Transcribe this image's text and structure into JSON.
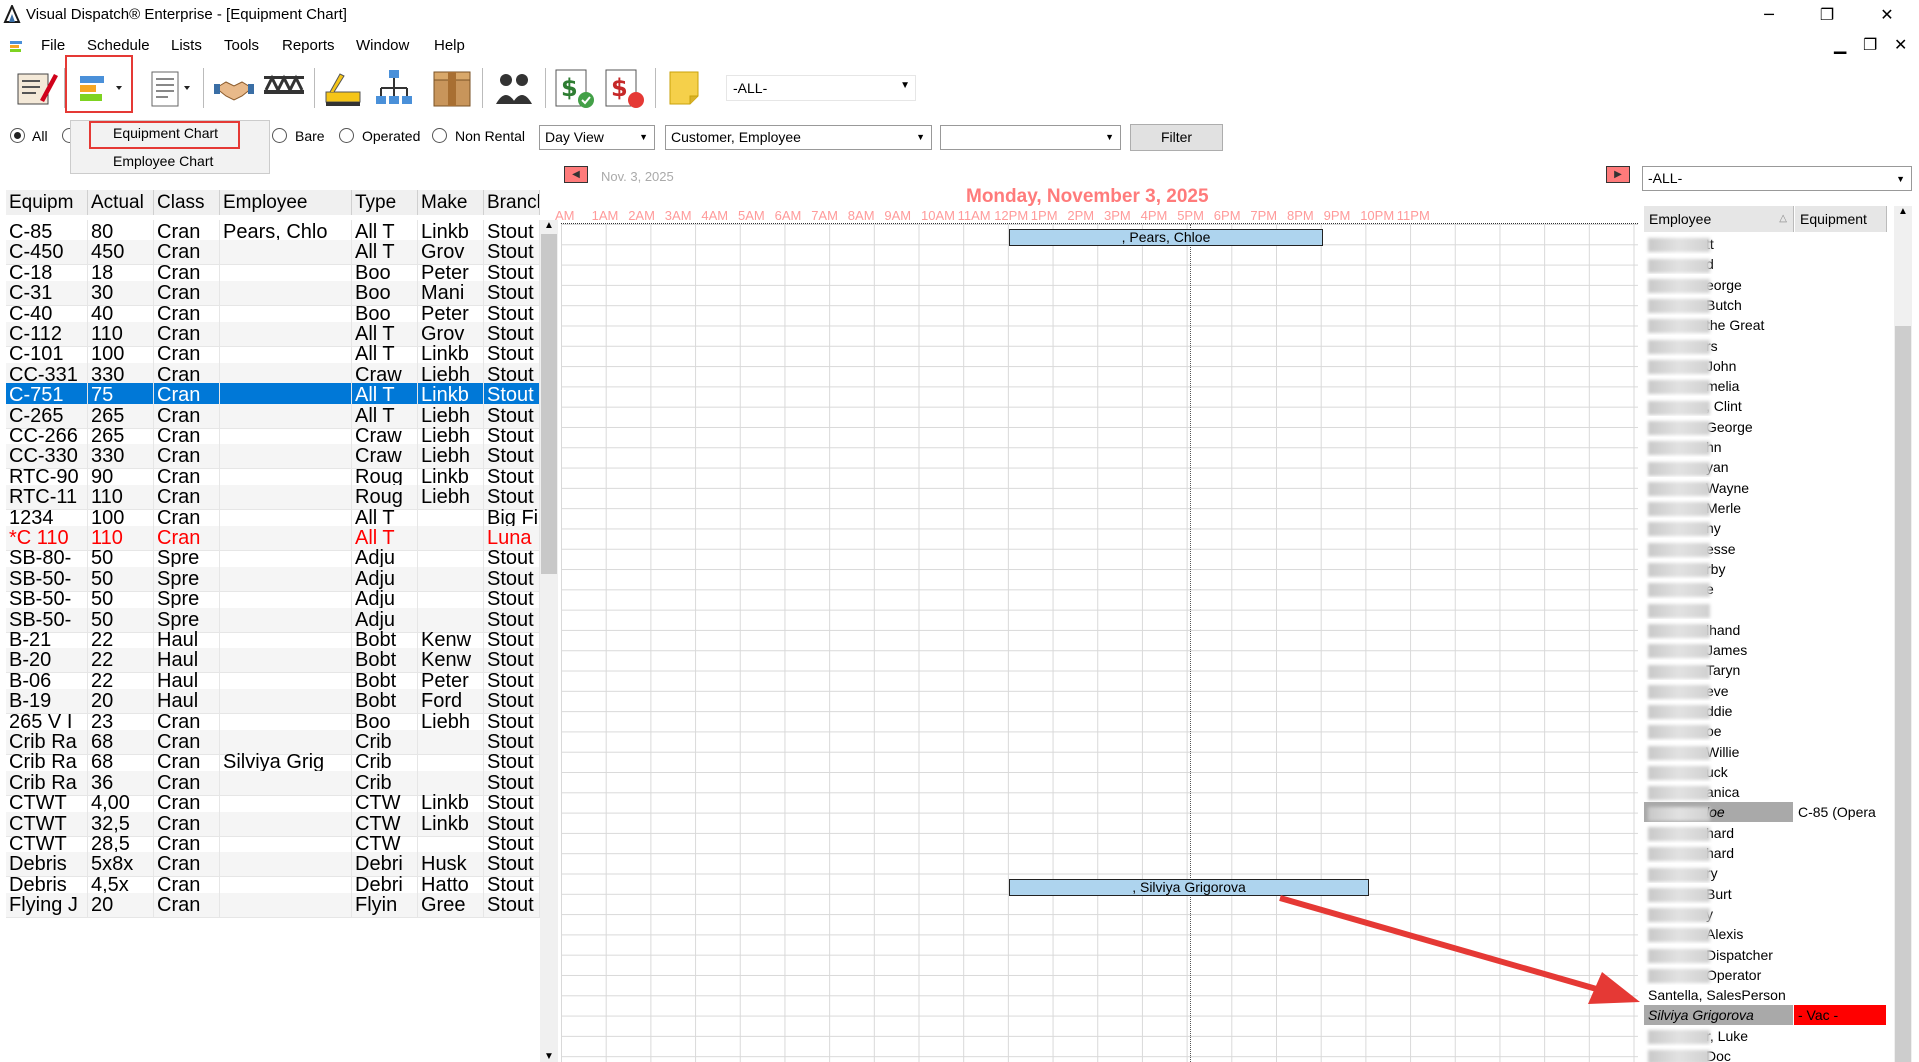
{
  "window": {
    "title": "Visual Dispatch® Enterprise - [Equipment Chart]"
  },
  "menu": [
    "File",
    "Schedule",
    "Lists",
    "Tools",
    "Reports",
    "Window",
    "Help"
  ],
  "toolbar": {
    "all_select": "-ALL-"
  },
  "chart_menu": {
    "equipment": "Equipment Chart",
    "employee": "Employee Chart"
  },
  "filters": {
    "radio_all": "All",
    "radio_bare": "Bare",
    "radio_operated": "Operated",
    "radio_nonrental": "Non Rental",
    "view": "Day View",
    "group": "Customer, Employee",
    "third": "",
    "filter_button": "Filter"
  },
  "grid": {
    "columns": [
      "Equipm",
      "Actual",
      "Class",
      "Employee",
      "Type",
      "Make",
      "Branch"
    ],
    "rows": [
      [
        "C-85",
        "80",
        "Cran",
        "Pears, Chlo",
        "All T",
        "Linkb",
        "Stout"
      ],
      [
        "C-450",
        "450",
        "Cran",
        "",
        "All T",
        "Grov",
        "Stout"
      ],
      [
        "C-18",
        "18",
        "Cran",
        "",
        "Boo",
        "Peter",
        "Stout"
      ],
      [
        "C-31",
        "30",
        "Cran",
        "",
        "Boo",
        "Mani",
        "Stout"
      ],
      [
        "C-40",
        "40",
        "Cran",
        "",
        "Boo",
        "Peter",
        "Stout"
      ],
      [
        "C-112",
        "110",
        "Cran",
        "",
        "All T",
        "Grov",
        "Stout"
      ],
      [
        "C-101",
        "100",
        "Cran",
        "",
        "All T",
        "Linkb",
        "Stout"
      ],
      [
        "CC-331",
        "330",
        "Cran",
        "",
        "Craw",
        "Liebh",
        "Stout"
      ],
      [
        "C-751",
        "75",
        "Cran",
        "",
        "All T",
        "Linkb",
        "Stout"
      ],
      [
        "C-265",
        "265",
        "Cran",
        "",
        "All T",
        "Liebh",
        "Stout"
      ],
      [
        "CC-266",
        "265",
        "Cran",
        "",
        "Craw",
        "Liebh",
        "Stout"
      ],
      [
        "CC-330",
        "330",
        "Cran",
        "",
        "Craw",
        "Liebh",
        "Stout"
      ],
      [
        "RTC-90",
        "90",
        "Cran",
        "",
        "Roug",
        "Linkb",
        "Stout"
      ],
      [
        "RTC-11",
        "110",
        "Cran",
        "",
        "Roug",
        "Liebh",
        "Stout"
      ],
      [
        "1234",
        "100",
        "Cran",
        "",
        "All T",
        "",
        "Big Fi"
      ],
      [
        "*C 110",
        "110",
        "Cran",
        "",
        "All T",
        "",
        "Luna"
      ],
      [
        "SB-80-",
        "50",
        "Spre",
        "",
        "Adju",
        "",
        "Stout"
      ],
      [
        "SB-50-",
        "50",
        "Spre",
        "",
        "Adju",
        "",
        "Stout"
      ],
      [
        "SB-50-",
        "50",
        "Spre",
        "",
        "Adju",
        "",
        "Stout"
      ],
      [
        "SB-50-",
        "50",
        "Spre",
        "",
        "Adju",
        "",
        "Stout"
      ],
      [
        "B-21",
        "22",
        "Haul",
        "",
        "Bobt",
        "Kenw",
        "Stout"
      ],
      [
        "B-20",
        "22",
        "Haul",
        "",
        "Bobt",
        "Kenw",
        "Stout"
      ],
      [
        "B-06",
        "22",
        "Haul",
        "",
        "Bobt",
        "Peter",
        "Stout"
      ],
      [
        "B-19",
        "20",
        "Haul",
        "",
        "Bobt",
        "Ford",
        "Stout"
      ],
      [
        "265 V I",
        "23",
        "Cran",
        "",
        "Boo",
        "Liebh",
        "Stout"
      ],
      [
        "Crib Ra",
        "68",
        "Cran",
        "",
        "Crib",
        "",
        "Stout"
      ],
      [
        "Crib Ra",
        "68",
        "Cran",
        "Silviya Grig",
        "Crib",
        "",
        "Stout"
      ],
      [
        "Crib Ra",
        "36",
        "Cran",
        "",
        "Crib",
        "",
        "Stout"
      ],
      [
        "CTWT",
        "4,00",
        "Cran",
        "",
        "CTW",
        "Linkb",
        "Stout"
      ],
      [
        "CTWT",
        "32,5",
        "Cran",
        "",
        "CTW",
        "Linkb",
        "Stout"
      ],
      [
        "CTWT",
        "28,5",
        "Cran",
        "",
        "CTW",
        "",
        "Stout"
      ],
      [
        "Debris",
        "5x8x",
        "Cran",
        "",
        "Debri",
        "Husk",
        "Stout"
      ],
      [
        "Debris",
        "4,5x",
        "Cran",
        "",
        "Debri",
        "Hatto",
        "Stout"
      ],
      [
        "Flying J",
        "20",
        "Cran",
        "",
        "Flyin",
        "Gree",
        "Stout"
      ]
    ]
  },
  "chart": {
    "date_small": "Nov. 3, 2025",
    "date_big": "Monday, November 3, 2025",
    "hours": [
      "AM",
      "1AM",
      "2AM",
      "3AM",
      "4AM",
      "5AM",
      "6AM",
      "7AM",
      "8AM",
      "9AM",
      "10AM",
      "11AM",
      "12PM",
      "1PM",
      "2PM",
      "3PM",
      "4PM",
      "5PM",
      "6PM",
      "7PM",
      "8PM",
      "9PM",
      "10PM",
      "11PM"
    ],
    "bars": [
      ", Pears, Chloe",
      ", Silviya Grigorova"
    ]
  },
  "employees": {
    "select": "-ALL-",
    "head_employee": "Employee",
    "head_equipment": "Equipment",
    "rows": [
      {
        "name": "tt",
        "equip": ""
      },
      {
        "name": "d",
        "equip": ""
      },
      {
        "name": "eorge",
        "equip": ""
      },
      {
        "name": "Butch",
        "equip": ""
      },
      {
        "name": "the Great",
        "equip": ""
      },
      {
        "name": "rs",
        "equip": ""
      },
      {
        "name": "John",
        "equip": ""
      },
      {
        "name": "melia",
        "equip": ""
      },
      {
        "name": ", Clint",
        "equip": ""
      },
      {
        "name": "George",
        "equip": ""
      },
      {
        "name": "hn",
        "equip": ""
      },
      {
        "name": "yan",
        "equip": ""
      },
      {
        "name": "Wayne",
        "equip": ""
      },
      {
        "name": "Merle",
        "equip": ""
      },
      {
        "name": "ny",
        "equip": ""
      },
      {
        "name": "esse",
        "equip": ""
      },
      {
        "name": "rby",
        "equip": ""
      },
      {
        "name": "e",
        "equip": ""
      },
      {
        "name": "",
        "equip": ""
      },
      {
        "name": "lhand",
        "equip": ""
      },
      {
        "name": "James",
        "equip": ""
      },
      {
        "name": "Taryn",
        "equip": ""
      },
      {
        "name": "eve",
        "equip": ""
      },
      {
        "name": "ddie",
        "equip": ""
      },
      {
        "name": "oe",
        "equip": ""
      },
      {
        "name": "Willie",
        "equip": ""
      },
      {
        "name": "uck",
        "equip": ""
      },
      {
        "name": "anica",
        "equip": ""
      },
      {
        "name": "loe",
        "equip": "C-85 (Opera"
      },
      {
        "name": "hard",
        "equip": ""
      },
      {
        "name": "hard",
        "equip": ""
      },
      {
        "name": "ry",
        "equip": ""
      },
      {
        "name": "Burt",
        "equip": ""
      },
      {
        "name": "y",
        "equip": ""
      },
      {
        "name": "Alexis",
        "equip": ""
      },
      {
        "name": "Dispatcher",
        "equip": ""
      },
      {
        "name": "Operator",
        "equip": ""
      },
      {
        "name": "Santella, SalesPerson",
        "equip": ""
      },
      {
        "name": "Silviya Grigorova",
        "equip": "- Vac -"
      },
      {
        "name": "r, Luke",
        "equip": ""
      },
      {
        "name": "Doc",
        "equip": ""
      }
    ]
  },
  "colors": {
    "selection": "#0078d7",
    "annotation": "#e53935",
    "bar": "#aed4ee",
    "vacation": "#ff0000",
    "date_header": "#ff7b7b"
  }
}
